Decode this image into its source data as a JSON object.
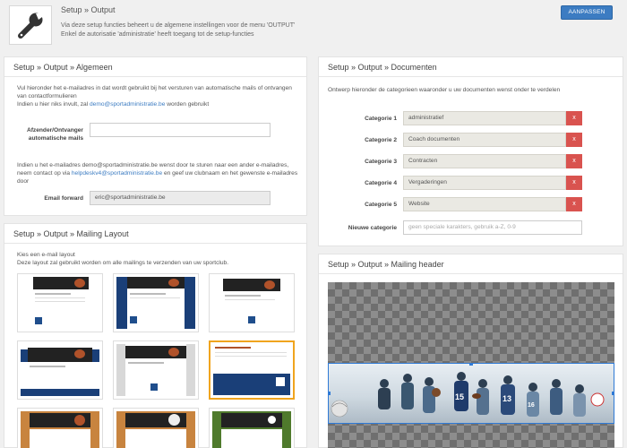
{
  "header": {
    "title": "Setup » Output",
    "desc_line1": "Via deze setup functies beheert u de algemene instellingen voor de menu 'OUTPUT'",
    "desc_line2": "Enkel de autorisatie 'administratie' heeft toegang tot de setup-functies",
    "button_label": "AANPASSEN",
    "logo_icon": "wrench-icon"
  },
  "algemeen": {
    "title": "Setup » Output » Algemeen",
    "intro_line1": "Vul hieronder het e-mailadres in dat wordt gebruikt bij het versturen van automatische mails of ontvangen",
    "intro_line2": "van contactformulieren",
    "intro_line3_pre": "Indien u hier niks invult, zal ",
    "intro_link": "demo@sportadministratie.be",
    "intro_line3_post": " worden gebruikt",
    "sender_label_1": "Afzender/Ontvanger",
    "sender_label_2": "automatische mails",
    "sender_value": "",
    "fwd_line1": "Indien u het e-mailadres demo@sportadministratie.be wenst door te sturen naar een ander e-mailadres,",
    "fwd_line2_pre": "neem contact op via ",
    "fwd_link": "helpdeskv4@sportadministratie.be",
    "fwd_line2_post": " en geef uw clubnaam en het gewenste e-mailadres",
    "fwd_line3": "door",
    "forward_label": "Email forward",
    "forward_value": "eric@sportadministratie.be"
  },
  "documenten": {
    "title": "Setup » Output » Documenten",
    "intro": "Ontwerp hieronder de categorieen waaronder u uw documenten wenst onder te verdelen",
    "categories": [
      {
        "label": "Categorie 1",
        "value": "administratief"
      },
      {
        "label": "Categorie 2",
        "value": "Coach documenten"
      },
      {
        "label": "Categorie 3",
        "value": "Contracten"
      },
      {
        "label": "Categorie 4",
        "value": "Vergaderingen"
      },
      {
        "label": "Categorie 5",
        "value": "Website"
      }
    ],
    "delete_label": "x",
    "new_label": "Nieuwe categorie",
    "new_placeholder": "geen speciale karakters, gebruik a-Z, 0-9"
  },
  "mailing_layout": {
    "title": "Setup » Output » Mailing Layout",
    "intro_line1": "Kies een e-mail layout",
    "intro_line2": "Deze layout zal gebruikt worden om alle mailings te verzenden van uw sportclub.",
    "selected_index": 5
  },
  "mailing_header": {
    "title": "Setup » Output » Mailing header",
    "jerseys": [
      "15",
      "13",
      "16"
    ]
  },
  "colors": {
    "primary": "#3c7cc2",
    "danger": "#d9534f",
    "selected_border": "#f0a41e",
    "crop_border": "#2f7ad6"
  }
}
